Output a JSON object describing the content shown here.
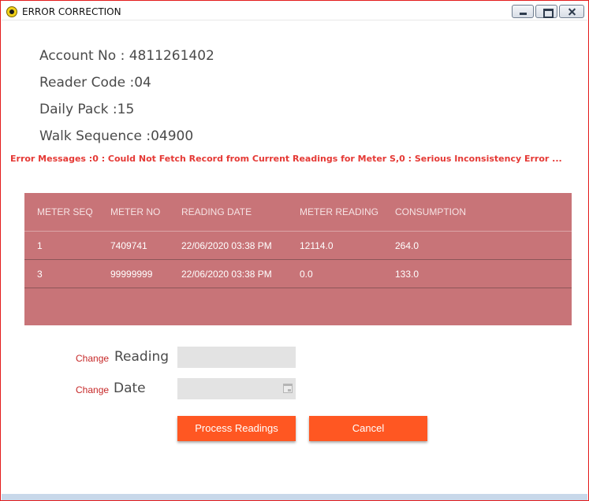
{
  "window": {
    "title": "ERROR CORRECTION",
    "controls": {
      "minimize": "minimize-icon",
      "maximize": "maximize-icon",
      "close": "close-icon"
    }
  },
  "account": {
    "account_no": "Account No : 4811261402",
    "reader_code": "Reader Code :04",
    "daily_pack": "Daily Pack :15",
    "walk_sequence": "Walk Sequence :04900"
  },
  "error_message": "Error Messages :0 : Could Not Fetch Record from Current Readings for Meter S,0 : Serious Inconsistency Error ...",
  "grid": {
    "columns": [
      "METER SEQ",
      "METER NO",
      "READING DATE",
      "METER READING",
      "CONSUMPTION"
    ],
    "rows": [
      [
        "1",
        "7409741",
        "22/06/2020 03:38 PM",
        "12114.0",
        "264.0"
      ],
      [
        "3",
        "99999999",
        "22/06/2020 03:38 PM",
        "0.0",
        "133.0"
      ]
    ]
  },
  "form": {
    "reading": {
      "change_label": "Change",
      "label": "Reading",
      "value": ""
    },
    "date": {
      "change_label": "Change",
      "label": "Date",
      "value": ""
    }
  },
  "buttons": {
    "process": "Process Readings",
    "cancel": "Cancel"
  },
  "colors": {
    "accent": "#ff5722",
    "grid_background": "#c87478",
    "error_text": "#e53935",
    "window_border": "#e31c1c"
  }
}
